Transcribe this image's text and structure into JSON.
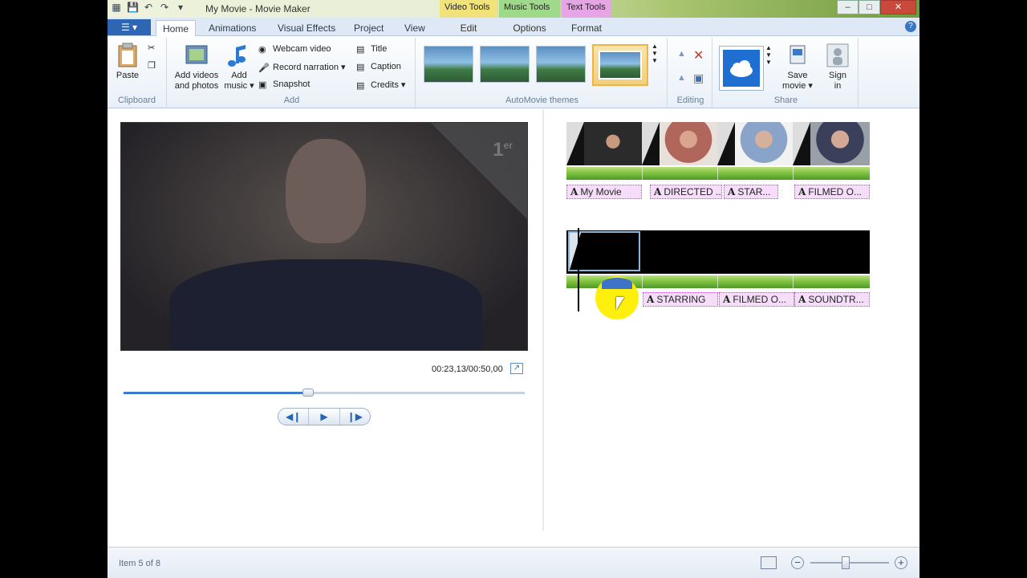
{
  "window": {
    "title": "My Movie - Movie Maker",
    "context_tabs": [
      "Video Tools",
      "Music Tools",
      "Text Tools"
    ],
    "buttons": [
      "‒",
      "□",
      "✕"
    ]
  },
  "qat_icons": [
    "film-icon",
    "save-icon",
    "undo-icon",
    "redo-icon",
    "customize-qat-icon"
  ],
  "tabs": {
    "file": "☰ ▾",
    "items": [
      "Home",
      "Animations",
      "Visual Effects",
      "Project",
      "View"
    ],
    "context": [
      "Edit",
      "Options",
      "Format"
    ],
    "active": "Home"
  },
  "ribbon": {
    "clipboard": {
      "label": "Clipboard",
      "paste": "Paste"
    },
    "add": {
      "label": "Add",
      "add_videos_1": "Add videos",
      "add_videos_2": "and photos",
      "add_music_1": "Add",
      "add_music_2": "music ▾",
      "webcam": "Webcam video",
      "narration": "Record narration ▾",
      "snapshot": "Snapshot",
      "title": "Title",
      "caption": "Caption",
      "credits": "Credits ▾"
    },
    "themes": {
      "label": "AutoMovie themes"
    },
    "editing": {
      "label": "Editing"
    },
    "share": {
      "label": "Share",
      "save_1": "Save",
      "save_2": "movie ▾",
      "sign_1": "Sign",
      "sign_2": "in"
    }
  },
  "preview": {
    "overlay": "1",
    "overlay_sup": "er",
    "timecode": "00:23,13/00:50,00",
    "progress": 0.46,
    "transport": [
      "◀❙",
      "▶",
      "❙▶"
    ]
  },
  "storyboard": {
    "row1_captions": [
      "My Movie",
      "DIRECTED ...",
      "STAR...",
      "FILMED O..."
    ],
    "row2_captions": [
      "STARRING",
      "FILMED O...",
      "SOUNDTR..."
    ],
    "caption_glyph": "A"
  },
  "status": {
    "item_text": "Item 5 of 8",
    "zoom_out": "−",
    "zoom_in": "+",
    "zoom_level": 0.45
  },
  "colors": {
    "accent": "#2f66b3",
    "video_tools": "#f2e27a",
    "music_tools": "#9fd98a",
    "text_tools": "#e6a6e6",
    "audio_track": "#7cc13f",
    "caption_bg": "#f6defa"
  }
}
